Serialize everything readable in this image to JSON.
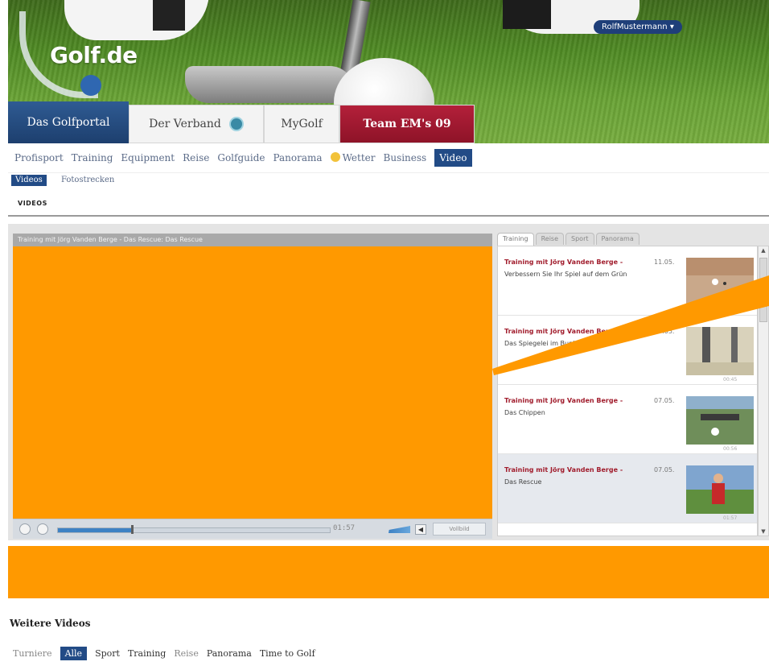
{
  "header": {
    "logo_text": "Golf.de",
    "user_menu": "RolfMustermann ▾"
  },
  "main_tabs": [
    {
      "label": "Das Golfportal",
      "active": true
    },
    {
      "label": "Der Verband",
      "active": false
    },
    {
      "label": "MyGolf",
      "active": false
    },
    {
      "label": "Team EM's 09",
      "active": false
    }
  ],
  "sub_nav": [
    "Profisport",
    "Training",
    "Equipment",
    "Reise",
    "Golfguide",
    "Panorama",
    "Wetter",
    "Business",
    "Video"
  ],
  "sub_nav_active": "Video",
  "tertiary_nav": {
    "active": "Videos",
    "other": "Fotostrecken"
  },
  "section_title": "VIDEOS",
  "player": {
    "title": "Training mit Jörg Vanden Berge - Das Rescue: Das Rescue",
    "time": "01:57",
    "fullscreen_label": "Vollbild",
    "progress": 0.27
  },
  "side_tabs": [
    "Training",
    "Reise",
    "Sport",
    "Panorama"
  ],
  "video_list": [
    {
      "title": "Training mit Jörg Vanden Berge -",
      "date": "11.05.",
      "desc": "Verbessern Sie Ihr Spiel auf dem Grün",
      "duration": "",
      "active": false
    },
    {
      "title": "Training mit Jörg Vanden Berge -",
      "date": "07.05.",
      "desc": "Das Spiegelei im Bunker",
      "duration": "00:45",
      "active": false
    },
    {
      "title": "Training mit Jörg Vanden Berge -",
      "date": "07.05.",
      "desc": "Das Chippen",
      "duration": "00:56",
      "active": false
    },
    {
      "title": "Training mit Jörg Vanden Berge -",
      "date": "07.05.",
      "desc": "Das Rescue",
      "duration": "01:57",
      "active": true
    }
  ],
  "more_videos": {
    "title": "Weitere Videos",
    "tabs": [
      "Turniere",
      "Alle",
      "Sport",
      "Training",
      "Reise",
      "Panorama",
      "Time to Golf"
    ],
    "active": "Alle"
  },
  "colors": {
    "player_orange": "#ff9900",
    "nav_blue": "#224b86",
    "team_red": "#a11d2d"
  }
}
